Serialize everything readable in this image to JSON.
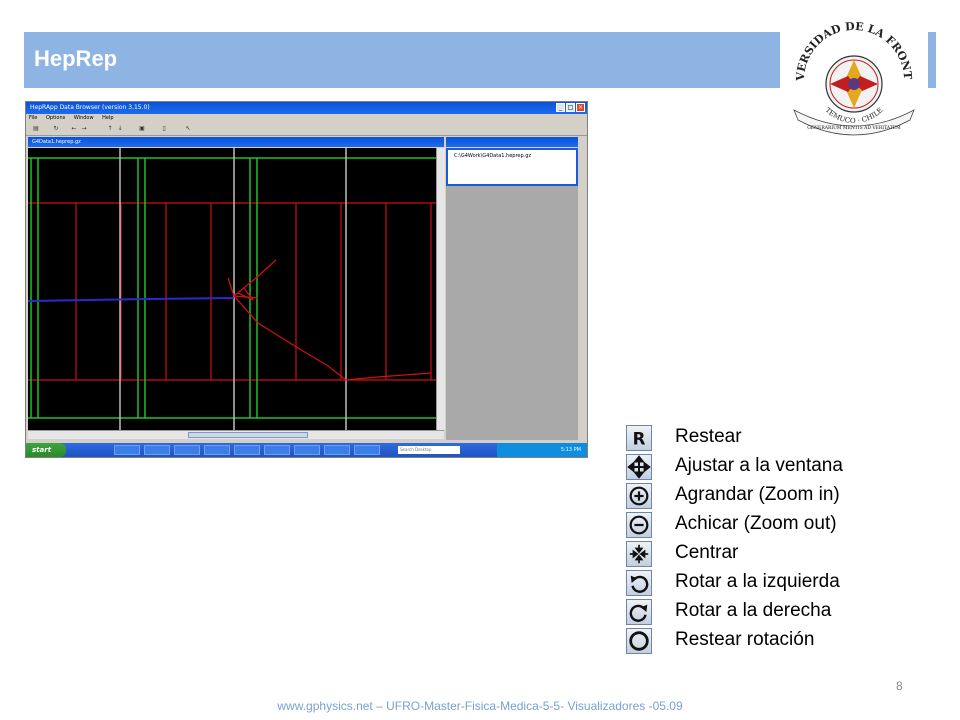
{
  "slide": {
    "title": "HepRep",
    "page_number": "8",
    "footer": "www.gphysics.net – UFRO-Master-Fisica-Medica-5-5- Visualizadores -05.09"
  },
  "logo": {
    "arc_text": "UNIVERSIDAD DE LA FRONTERA",
    "city_text": "TEMUCO · CHILE",
    "motto": "GENERARIUM MENTIS AD VERITATEM"
  },
  "app": {
    "window_title": "HepRApp Data Browser (version 3.15.0)",
    "menu": [
      "File",
      "Options",
      "Window",
      "Help"
    ],
    "document_title": "G4Data1.heprep.gz",
    "tree_item": "C:\\G4Work\\G4Data1.heprep.gz",
    "taskbar_start": "start",
    "search_placeholder": "Search Desktop",
    "clock": "5:13 PM"
  },
  "legend": [
    {
      "icon": "reset-icon",
      "glyph": "R",
      "label": "Restear"
    },
    {
      "icon": "fit-window-icon",
      "glyph": "✥",
      "label": "Ajustar a la ventana"
    },
    {
      "icon": "zoom-in-icon",
      "glyph": "⊕",
      "label": "Agrandar (Zoom in)"
    },
    {
      "icon": "zoom-out-icon",
      "glyph": "⊖",
      "label": "Achicar (Zoom out)"
    },
    {
      "icon": "center-icon",
      "glyph": "✣",
      "label": "Centrar"
    },
    {
      "icon": "rotate-left-icon",
      "glyph": "↺",
      "label": "Rotar a la izquierda"
    },
    {
      "icon": "rotate-right-icon",
      "glyph": "↻",
      "label": "Rotar a la derecha"
    },
    {
      "icon": "reset-rotation-icon",
      "glyph": "◯",
      "label": "Restear rotación"
    }
  ],
  "colors": {
    "header_bar": "#8eb4e3",
    "footer_text": "#7aa0d0",
    "geometry_red": "#cc1111",
    "geometry_green": "#1fbf2a",
    "track_blue": "#2a2ad0"
  }
}
